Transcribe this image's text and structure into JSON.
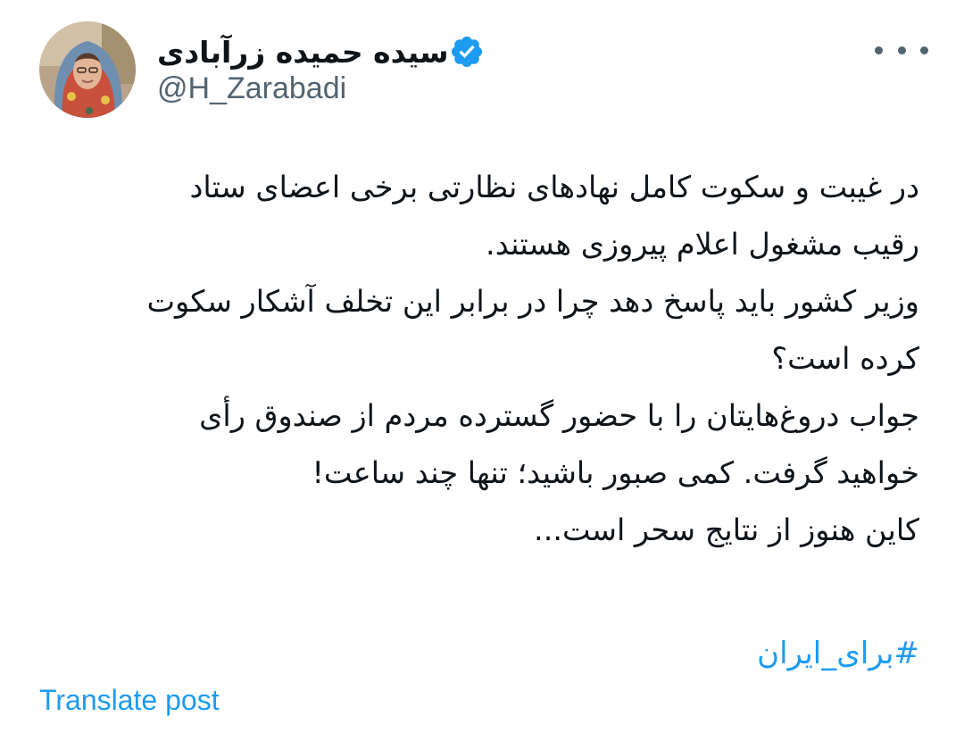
{
  "author": {
    "display_name": "سیده حمیده زرآبادی",
    "handle": "@H_Zarabadi",
    "verified": true,
    "avatar_icon": "profile-photo"
  },
  "actions": {
    "more_icon": "more-horizontal-icon"
  },
  "post": {
    "lines": [
      "در غیبت و سکوت کامل نهادهای نظارتی برخی اعضای ستاد",
      "رقیب مشغول اعلام پیروزی هستند.",
      "وزیر کشور باید پاسخ دهد چرا در برابر این تخلف آشکار سکوت",
      "کرده است؟",
      "جواب دروغ‌هایتان را با حضور گسترده مردم از صندوق رأی",
      "خواهید گرفت. کمی صبور باشید؛ تنها چند ساعت!",
      "کاین هنوز از نتایج سحر است..."
    ],
    "hashtag": "#برای_ایران"
  },
  "translate_label": "Translate post",
  "colors": {
    "link": "#1d9bf0",
    "secondary_text": "#536471",
    "primary_text": "#0f1419",
    "verified_badge": "#1d9bf0"
  }
}
